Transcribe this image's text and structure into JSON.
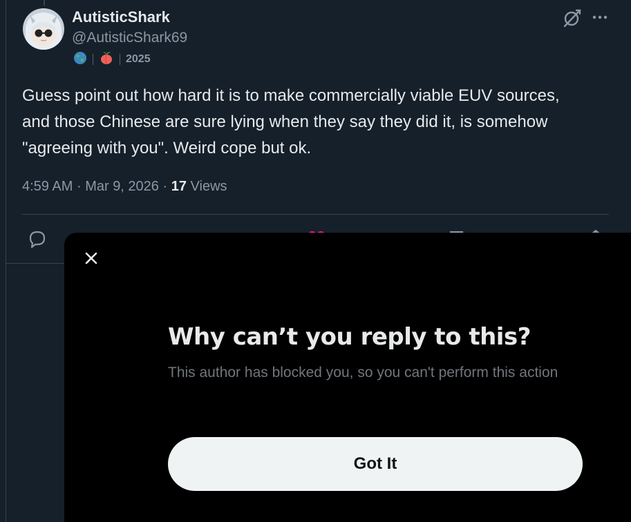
{
  "tweet": {
    "display_name": "AutisticShark",
    "handle": "@AutisticShark69",
    "badges": {
      "globe_icon": "globe-emoji",
      "peach_icon": "peach-emoji",
      "year": "2025"
    },
    "text_lines": [
      "Guess point out how hard it is to make commercially viable EUV sources,",
      "and those Chinese are sure lying when they say they did it, is somehow",
      "\"agreeing with you\". Weird cope but ok."
    ],
    "time": "4:59 AM",
    "date": "Mar 9, 2026",
    "separator": "·",
    "views_count": "17",
    "views_label": "Views"
  },
  "icons": {
    "grok": "grok-icon",
    "more": "more-icon",
    "reply": "reply-icon",
    "retweet": "retweet-icon",
    "like": "like-icon",
    "bookmark": "bookmark-icon",
    "share": "share-icon",
    "close": "close-icon"
  },
  "modal": {
    "title": "Why can’t you reply to this?",
    "message": "This author has blocked you, so you can't perform this action",
    "button_label": "Got It"
  },
  "colors": {
    "background": "#15202b",
    "modal_background": "#000000",
    "primary_text": "#e7e9ea",
    "secondary_text": "#8b98a5",
    "button_background": "#eff3f4",
    "like_pink": "#f91880"
  }
}
